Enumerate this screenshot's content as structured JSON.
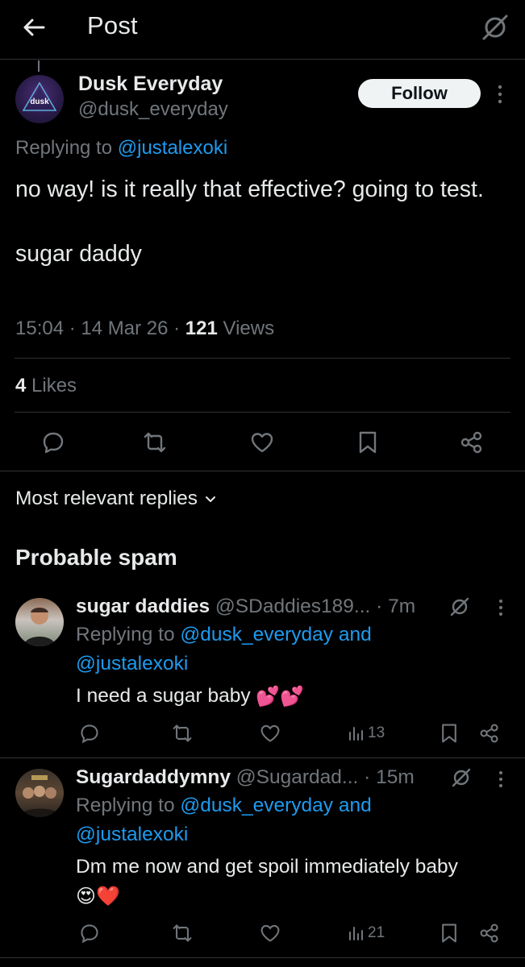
{
  "header": {
    "title": "Post",
    "back_icon": "arrow-left-icon",
    "right_icon": "grok-icon"
  },
  "post": {
    "author": {
      "name": "Dusk Everyday",
      "handle": "@dusk_everyday",
      "avatar_text": "dusk"
    },
    "follow_label": "Follow",
    "replying_prefix": "Replying to",
    "replying_to": "@justalexoki",
    "body_line1": "no way! is it really that effective? going to test.",
    "body_line2": "sugar daddy",
    "time": "15:04",
    "date": "14 Mar 26",
    "views_count": "121",
    "views_label": "Views",
    "likes_count": "4",
    "likes_label": "Likes",
    "actions": [
      "reply-icon",
      "repost-icon",
      "like-icon",
      "bookmark-icon",
      "share-icon"
    ]
  },
  "replies_section": {
    "sort_label": "Most relevant replies",
    "spam_heading": "Probable spam"
  },
  "replies": [
    {
      "name": "sugar daddies",
      "handle": "@SDaddies189...",
      "time": "· 7m",
      "replying_prefix": "Replying to",
      "mention1": "@dusk_everyday",
      "and": "and",
      "mention2": "@justalexoki",
      "body": "I need a sugar baby",
      "emoji": "💕💕",
      "views": "13"
    },
    {
      "name": "Sugardaddymny",
      "handle": "@Sugardad...",
      "time": "· 15m",
      "replying_prefix": "Replying to",
      "mention1": "@dusk_everyday",
      "and": "and",
      "mention2": "@justalexoki",
      "body": "Dm me now and get spoil immediately baby",
      "emoji": "😍❤️",
      "views": "21"
    }
  ],
  "colors": {
    "background": "#000000",
    "text": "#e7e9ea",
    "muted": "#71767b",
    "link": "#1d9bf0",
    "divider": "#2f3336"
  }
}
